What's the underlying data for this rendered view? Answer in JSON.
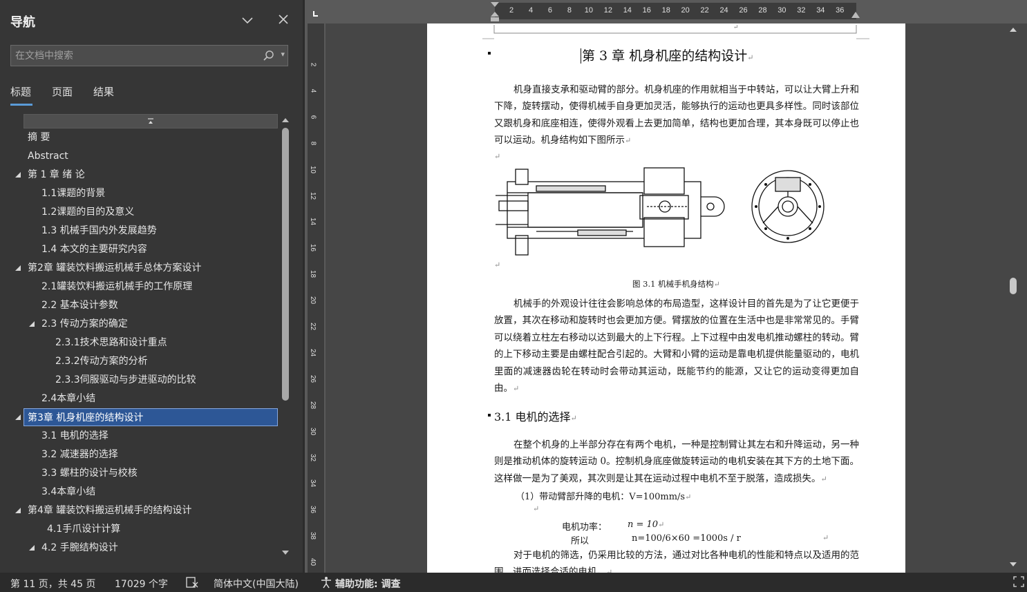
{
  "nav": {
    "title": "导航",
    "search_placeholder": "在文档中搜索",
    "tabs": [
      "标题",
      "页面",
      "结果"
    ],
    "items": [
      {
        "label": "摘  要",
        "level": 1,
        "expanded": null
      },
      {
        "label": "Abstract",
        "level": 1,
        "expanded": null
      },
      {
        "label": "第 1 章 绪  论",
        "level": 1,
        "expanded": true
      },
      {
        "label": "1.1课题的背景",
        "level": 2,
        "expanded": null
      },
      {
        "label": "1.2课题的目的及意义",
        "level": 2,
        "expanded": null
      },
      {
        "label": "1.3 机械手国内外发展趋势",
        "level": 2,
        "expanded": null
      },
      {
        "label": "1.4  本文的主要研究内容",
        "level": 2,
        "expanded": null
      },
      {
        "label": "第2章 罐装饮料搬运机械手总体方案设计",
        "level": 1,
        "expanded": true
      },
      {
        "label": "2.1罐装饮料搬运机械手的工作原理",
        "level": 2,
        "expanded": null
      },
      {
        "label": "2.2  基本设计参数",
        "level": 2,
        "expanded": null
      },
      {
        "label": "2.3  传动方案的确定",
        "level": 2,
        "expanded": true
      },
      {
        "label": "2.3.1技术思路和设计重点",
        "level": 3,
        "expanded": null
      },
      {
        "label": "2.3.2传动方案的分析",
        "level": 3,
        "expanded": null
      },
      {
        "label": "2.3.3伺服驱动与步进驱动的比较",
        "level": 3,
        "expanded": null
      },
      {
        "label": "2.4本章小结",
        "level": 2,
        "expanded": null
      },
      {
        "label": "第3章  机身机座的结构设计",
        "level": 1,
        "expanded": true,
        "selected": true
      },
      {
        "label": "3.1  电机的选择",
        "level": 2,
        "expanded": null
      },
      {
        "label": "3.2 减速器的选择",
        "level": 2,
        "expanded": null
      },
      {
        "label": "3.3  螺柱的设计与校核",
        "level": 2,
        "expanded": null
      },
      {
        "label": "3.4本章小结",
        "level": 2,
        "expanded": null
      },
      {
        "label": "第4章  罐装饮料搬运机械手的结构设计",
        "level": 1,
        "expanded": true
      },
      {
        "label": "4.1手爪设计计算",
        "level": 2,
        "expanded": null,
        "extra_indent": true
      },
      {
        "label": "4.2  手腕结构设计",
        "level": 2,
        "expanded": true
      }
    ]
  },
  "ruler": {
    "top_numbers": [
      "2",
      "4",
      "6",
      "8",
      "10",
      "12",
      "14",
      "16",
      "18",
      "20",
      "22",
      "24",
      "26",
      "28",
      "30",
      "32",
      "34",
      "36"
    ],
    "left_numbers": [
      "2",
      "4",
      "6",
      "8",
      "10",
      "12",
      "14",
      "16",
      "18",
      "20",
      "22",
      "24",
      "26",
      "28",
      "30",
      "32",
      "34",
      "36",
      "38",
      "40"
    ]
  },
  "document": {
    "chapter_title": "第 3 章    机身机座的结构设计",
    "para1": "机身直接支承和驱动臂的部分。机身机座的作用就相当于中转站，可以让大臂上升和下降，旋转摆动，使得机械手自身更加灵活，能够执行的运动也更具多样性。同时该部位又跟机身和底座相连，使得外观看上去更加简单，结构也更加合理，其本身既可以停止也可以运动。机身结构如下图所示",
    "figure_caption": "图 3.1  机械手机身结构",
    "para2": "机械手的外观设计往往会影响总体的布局造型，这样设计目的首先是为了让它更便于放置，其次在移动和旋转时也会更加方便。臂摆放的位置在生活中也是非常常见的。手臂可以绕着立柱左右移动以达到最大的上下行程。上下过程中由发电机推动螺柱的转动。臂的上下移动主要是由螺柱配合引起的。大臂和小臂的运动是靠电机提供能量驱动的，电机里面的减速器齿轮在转动时会带动其运动，既能节约的能源，又让它的运动变得更加自由。",
    "section_title": "3.1    电机的选择",
    "para3": "在整个机身的上半部分存在有两个电机，一种是控制臂让其左右和升降运动，另一种则是推动机体的旋转运动 0。控制机身底座做旋转运动的电机安装在其下方的土地下面。这样做一是为了美观，其次则是让其在运动过程中电机不至于脱落，造成损失。",
    "item1": "（1）带动臂部升降的电机：V=100mm/s",
    "motor_power_label": "电机功率：",
    "motor_power_value": "n = 10",
    "so_label": "所以",
    "so_value": "n=100/6×60 =1000s / r",
    "para4": "对于电机的筛选，仍采用比较的方法，通过对比各种电机的性能和特点以及适用的范围，进而选择合适的电机。"
  },
  "status": {
    "page": "第 11 页，共 45 页",
    "words": "17029 个字",
    "language": "简体中文(中国大陆)",
    "accessibility": "辅助功能: 调查"
  }
}
